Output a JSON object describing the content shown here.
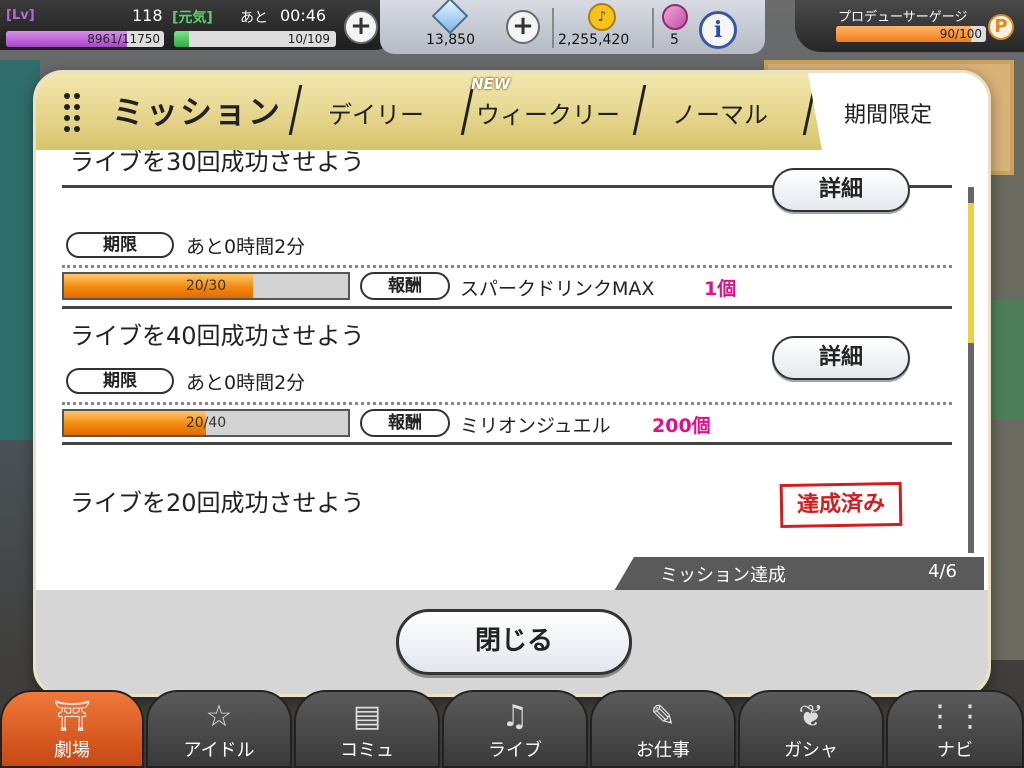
{
  "topbar": {
    "lv_tag": "[Lv]",
    "level": "118",
    "mood": "[元気]",
    "remain_label": "あと",
    "remain_time": "00:46",
    "exp_text": "8961/11750",
    "exp_fraction": 0.763,
    "stamina_text": "10/109",
    "stamina_fraction": 0.092,
    "jewels": "13,850",
    "money": "2,255,420",
    "tickets": "5",
    "info_label": "i",
    "plus_label": "+",
    "gauge_label": "プロデューサーゲージ",
    "gauge_text": "90/100",
    "gauge_fraction": 0.9,
    "gauge_badge": "P"
  },
  "dialog": {
    "title": "ミッション",
    "tabs": [
      {
        "label": "デイリー"
      },
      {
        "label": "ウィークリー"
      },
      {
        "label": "ノーマル"
      },
      {
        "label": "期間限定"
      }
    ],
    "new_badge": "NEW",
    "missions": [
      {
        "title": "ライブを30回成功させよう",
        "detail_label": "詳細",
        "deadline_tag": "期限",
        "deadline": "あと0時間2分",
        "progress_text": "20/30",
        "progress_fraction": 0.667,
        "reward_tag": "報酬",
        "reward_name": "スパークドリンクMAX",
        "reward_qty": "1個"
      },
      {
        "title": "ライブを40回成功させよう",
        "detail_label": "詳細",
        "deadline_tag": "期限",
        "deadline": "あと0時間2分",
        "progress_text": "20/40",
        "progress_fraction": 0.5,
        "reward_tag": "報酬",
        "reward_name": "ミリオンジュエル",
        "reward_qty": "200個"
      },
      {
        "title": "ライブを20回成功させよう",
        "stamp_label": "達成済み"
      }
    ],
    "achievement_label": "ミッション達成",
    "achievement_count": "4/6",
    "close_label": "閉じる"
  },
  "nav": {
    "items": [
      {
        "label": "劇場",
        "icon": "theater-icon",
        "active": true
      },
      {
        "label": "アイドル",
        "icon": "idol-icon",
        "active": false
      },
      {
        "label": "コミュ",
        "icon": "commu-icon",
        "active": false
      },
      {
        "label": "ライブ",
        "icon": "live-icon",
        "active": false
      },
      {
        "label": "お仕事",
        "icon": "work-icon",
        "active": false
      },
      {
        "label": "ガシャ",
        "icon": "gacha-icon",
        "active": false
      },
      {
        "label": "ナビ",
        "icon": "navi-icon",
        "active": false
      }
    ]
  },
  "colors": {
    "accent_gold": "#e4d48a",
    "reward_qty": "#e0108a",
    "progress_orange": "#f38a0f",
    "stamp_red": "#d01d1d",
    "nav_active": "#e0622a"
  }
}
